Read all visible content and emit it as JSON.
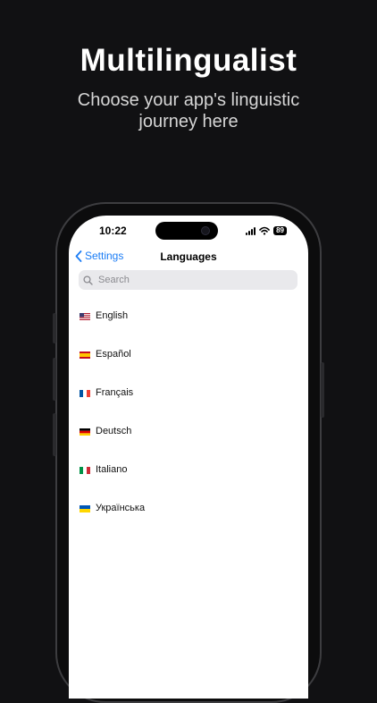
{
  "promo": {
    "title": "Multilingualist",
    "subtitle": "Choose your app's linguistic journey here"
  },
  "status_bar": {
    "time": "10:22",
    "battery": "89"
  },
  "nav": {
    "back_label": "Settings",
    "title": "Languages"
  },
  "search": {
    "placeholder": "Search"
  },
  "languages": [
    {
      "label": "English",
      "flag": "us-flag-icon"
    },
    {
      "label": "Español",
      "flag": "spain-flag-icon"
    },
    {
      "label": "Français",
      "flag": "france-flag-icon"
    },
    {
      "label": "Deutsch",
      "flag": "germany-flag-icon"
    },
    {
      "label": "Italiano",
      "flag": "italy-flag-icon"
    },
    {
      "label": "Українська",
      "flag": "ukraine-flag-icon"
    }
  ],
  "colors": {
    "background": "#111113",
    "accent": "#1a7cf5",
    "screen": "#ffffff"
  }
}
